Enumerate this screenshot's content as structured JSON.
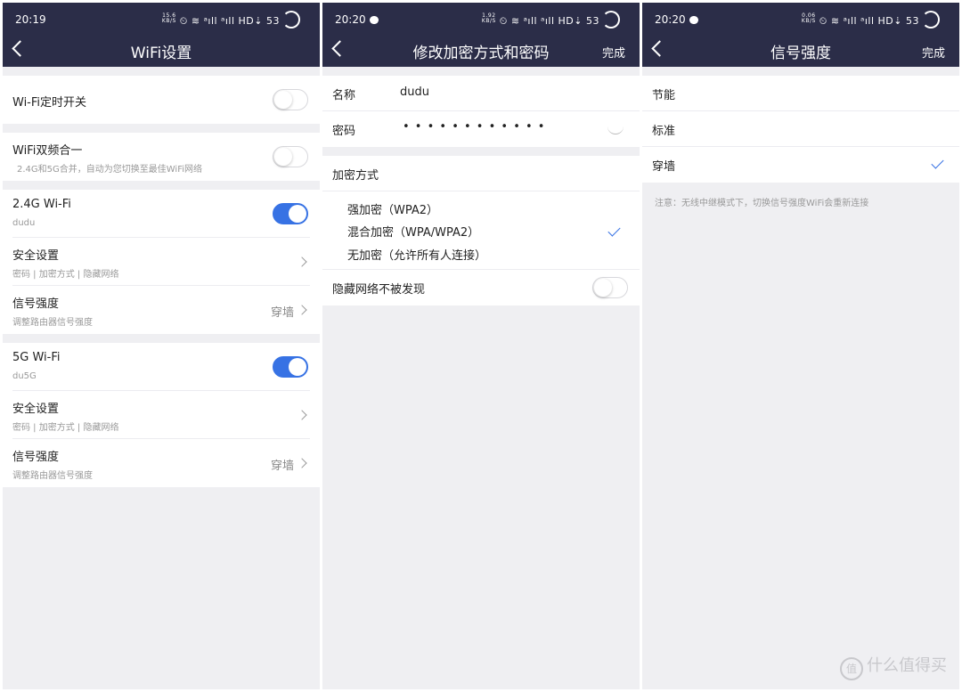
{
  "phone1": {
    "status": {
      "time": "20:19",
      "netspeed_top": "15.6",
      "netspeed_bottom": "KB/S",
      "signal": "⏲ ≋ ᵃıll ᵃıll HD⇣",
      "battery": "53"
    },
    "nav": {
      "title": "WiFi设置"
    },
    "timer_switch": {
      "label": "Wi-Fi定时开关",
      "on": false
    },
    "dual_band": {
      "label": "WiFi双频合一",
      "sub": "2.4G和5G合并，自动为您切换至最佳WiFi网络",
      "on": false
    },
    "wifi24": {
      "label": "2.4G Wi-Fi",
      "ssid": "dudu",
      "on": true
    },
    "security24": {
      "label": "安全设置",
      "sub": "密码 | 加密方式 | 隐藏网络"
    },
    "signal24": {
      "label": "信号强度",
      "sub": "调整路由器信号强度",
      "value": "穿墙"
    },
    "wifi5": {
      "label": "5G Wi-Fi",
      "ssid": "du5G",
      "on": true
    },
    "security5": {
      "label": "安全设置",
      "sub": "密码 | 加密方式 | 隐藏网络"
    },
    "signal5": {
      "label": "信号强度",
      "sub": "调整路由器信号强度",
      "value": "穿墙"
    }
  },
  "phone2": {
    "status": {
      "time": "20:20",
      "netspeed_top": "1.92",
      "netspeed_bottom": "KB/S",
      "signal": "⏲ ≋ ᵃıll ᵃıll HD⇣",
      "battery": "53"
    },
    "nav": {
      "title": "修改加密方式和密码",
      "done": "完成"
    },
    "name": {
      "label": "名称",
      "value": "dudu"
    },
    "password": {
      "label": "密码",
      "value": "• • • • • • • • • • • •"
    },
    "encryption": {
      "header": "加密方式",
      "options": [
        "强加密（WPA2）",
        "混合加密（WPA/WPA2）",
        "无加密（允许所有人连接）"
      ],
      "selected": 1
    },
    "hide": {
      "label": "隐藏网络不被发现",
      "on": false
    }
  },
  "phone3": {
    "status": {
      "time": "20:20",
      "netspeed_top": "0.06",
      "netspeed_bottom": "KB/S",
      "signal": "⏲ ≋ ᵃıll ᵃıll HD⇣",
      "battery": "53"
    },
    "nav": {
      "title": "信号强度",
      "done": "完成"
    },
    "options": [
      "节能",
      "标准",
      "穿墙"
    ],
    "selected": 2,
    "note": "注意：无线中继模式下，切换信号强度WiFi会重新连接"
  },
  "watermark": {
    "icon": "值",
    "text": "什么值得买"
  },
  "colors": {
    "navbar": "#2b2d48",
    "accent": "#3772e4",
    "background": "#efeff2"
  }
}
